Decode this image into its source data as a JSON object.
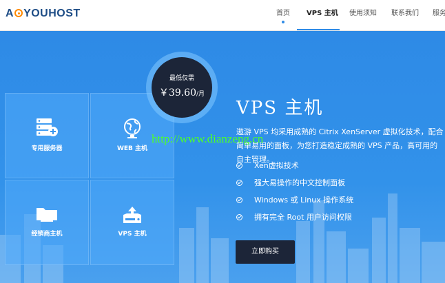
{
  "brand": {
    "logo_text_a": "A",
    "logo_text_b": "YOUHOST"
  },
  "nav": {
    "items": [
      "首页",
      "VPS 主机",
      "使用须知",
      "联系我们",
      "服务"
    ],
    "active": "VPS 主机"
  },
  "price": {
    "caption": "最低仅需",
    "value": "￥39.60",
    "unit": "/月"
  },
  "tiles": [
    {
      "label": "专用服务器",
      "icon": "server-icon"
    },
    {
      "label": "WEB 主机",
      "icon": "globe-icon"
    },
    {
      "label": "经销商主机",
      "icon": "folder-icon"
    },
    {
      "label": "VPS 主机",
      "icon": "vps-drive-icon"
    }
  ],
  "product": {
    "title": "VPS 主机",
    "description": "遨游 VPS 均采用成熟的 Citrix XenServer 虚拟化技术，配合简单易用的面板，为您打造稳定成熟的 VPS 产品，高可用的自主管理。",
    "features": [
      "Xen虚拟技术",
      "强大易操作的中文控制面板",
      "Windows 或 Linux 操作系统",
      "拥有完全 Root 用户访问权限"
    ],
    "buy_label": "立即购买"
  },
  "watermark": "http://www.dianzeng.cn",
  "colors": {
    "hero_bg": "#2f8be6",
    "dark": "#1c2538",
    "logo_blue": "#1e4d86",
    "logo_orange": "#ff8a00",
    "watermark_green": "#4dff2a"
  }
}
